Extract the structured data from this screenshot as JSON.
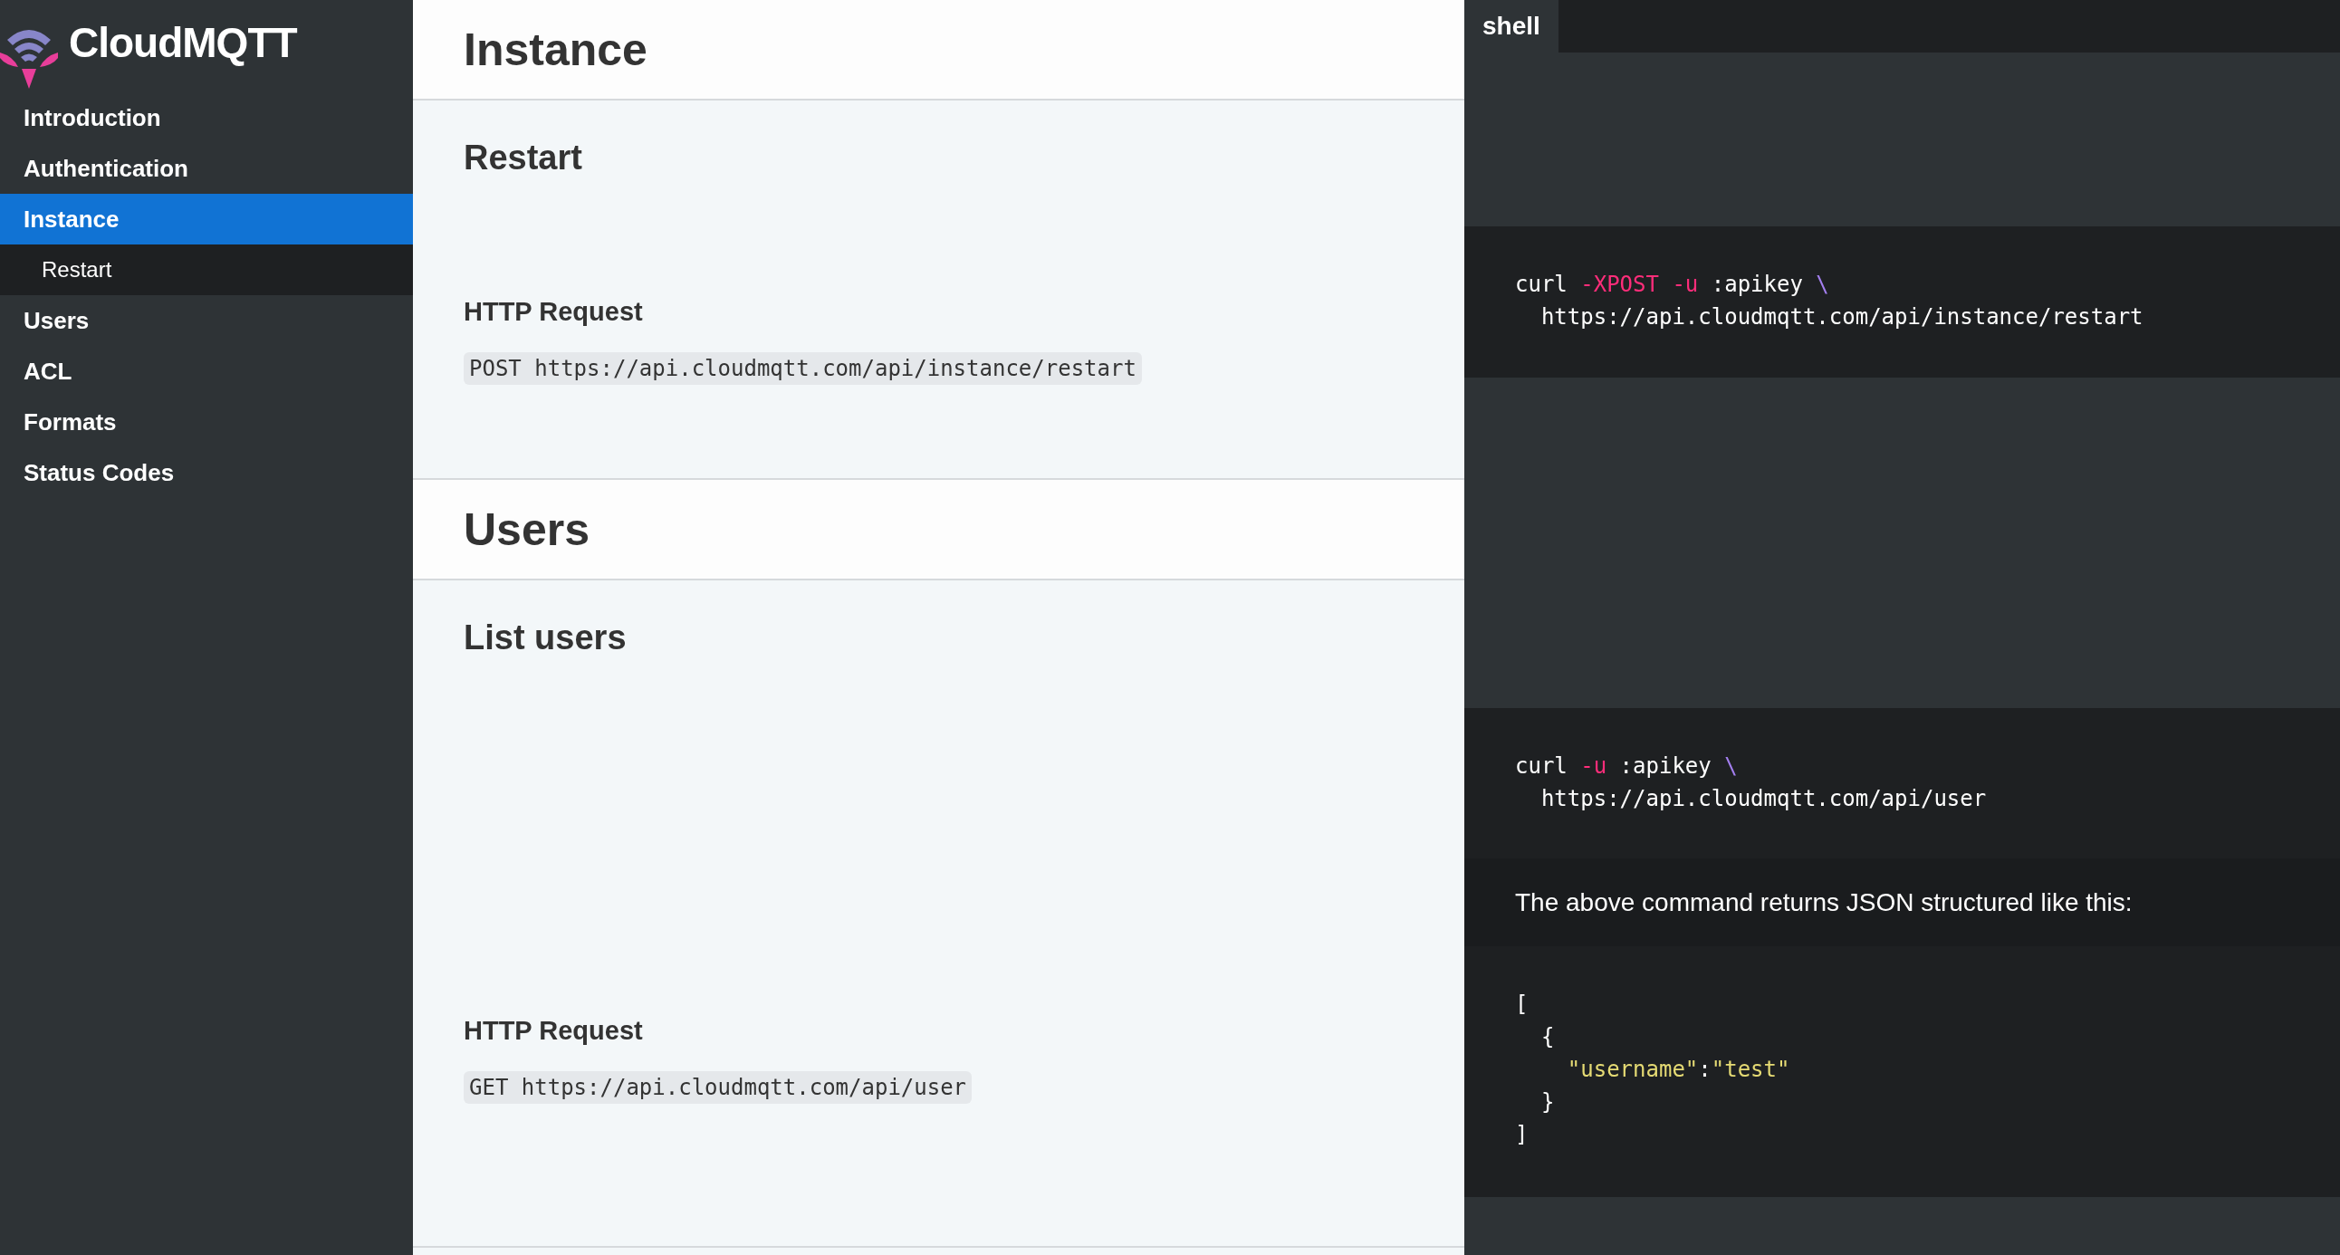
{
  "logo": {
    "text": "CloudMQTT"
  },
  "sidebar": {
    "items": [
      {
        "label": "Introduction",
        "selected": false
      },
      {
        "label": "Authentication",
        "selected": false
      },
      {
        "label": "Instance",
        "selected": true,
        "children": [
          {
            "label": "Restart",
            "selected": false
          }
        ]
      },
      {
        "label": "Users",
        "selected": false
      },
      {
        "label": "ACL",
        "selected": false
      },
      {
        "label": "Formats",
        "selected": false
      },
      {
        "label": "Status Codes",
        "selected": false
      }
    ]
  },
  "sections": [
    {
      "title": "Instance",
      "subsections": [
        {
          "title": "Restart",
          "request_heading": "HTTP Request",
          "request": "POST https://api.cloudmqtt.com/api/instance/restart"
        }
      ]
    },
    {
      "title": "Users",
      "subsections": [
        {
          "title": "List users",
          "request_heading": "HTTP Request",
          "request": "GET https://api.cloudmqtt.com/api/user"
        }
      ]
    }
  ],
  "code_panel": {
    "tabs": [
      {
        "label": "shell",
        "selected": true
      }
    ],
    "blocks": [
      {
        "kind": "code",
        "lines": [
          [
            {
              "text": "curl ",
              "kind": "plain"
            },
            {
              "text": "-XPOST ",
              "kind": "flag"
            },
            {
              "text": "-u",
              "kind": "flag"
            },
            {
              "text": " :apikey ",
              "kind": "plain"
            },
            {
              "text": "\\",
              "kind": "escape"
            }
          ],
          [
            {
              "text": "  https://api.cloudmqtt.com/api/instance/restart",
              "kind": "plain"
            }
          ]
        ]
      },
      {
        "kind": "code",
        "lines": [
          [
            {
              "text": "curl ",
              "kind": "plain"
            },
            {
              "text": "-u",
              "kind": "flag"
            },
            {
              "text": " :apikey ",
              "kind": "plain"
            },
            {
              "text": "\\",
              "kind": "escape"
            }
          ],
          [
            {
              "text": "  https://api.cloudmqtt.com/api/user",
              "kind": "plain"
            }
          ]
        ]
      },
      {
        "kind": "note",
        "text": "The above command returns JSON structured like this:"
      },
      {
        "kind": "code",
        "lines": [
          [
            {
              "text": "[",
              "kind": "plain"
            }
          ],
          [
            {
              "text": "  {",
              "kind": "plain"
            }
          ],
          [
            {
              "text": "    \"username\"",
              "kind": "string"
            },
            {
              "text": ":",
              "kind": "plain"
            },
            {
              "text": "\"test\"",
              "kind": "string"
            }
          ],
          [
            {
              "text": "  }",
              "kind": "plain"
            }
          ],
          [
            {
              "text": "]",
              "kind": "plain"
            }
          ]
        ]
      }
    ]
  }
}
